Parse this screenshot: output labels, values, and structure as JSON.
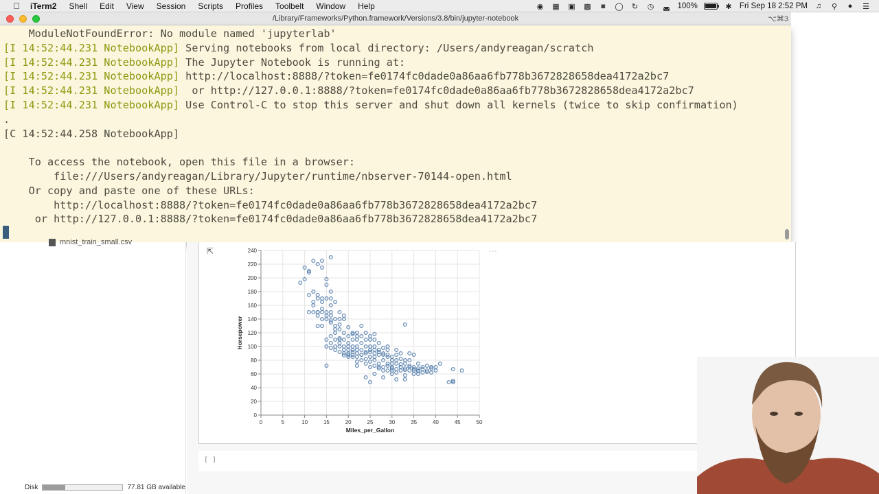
{
  "menubar": {
    "app_name": "iTerm2",
    "items": [
      "Shell",
      "Edit",
      "View",
      "Session",
      "Scripts",
      "Profiles",
      "Toolbelt",
      "Window",
      "Help"
    ],
    "battery_text": "100%",
    "battery_level": 1.0,
    "clock": "Fri Sep 18  2:52 PM"
  },
  "terminal": {
    "window_title": "/Library/Frameworks/Python.framework/Versions/3.8/bin/jupyter-notebook",
    "shortcut": "⌥⌘3",
    "lines": [
      {
        "tag": "",
        "text": "    ModuleNotFoundError: No module named 'jupyterlab'"
      },
      {
        "tag": "[I 14:52:44.231 NotebookApp]",
        "text": " Serving notebooks from local directory: /Users/andyreagan/scratch"
      },
      {
        "tag": "[I 14:52:44.231 NotebookApp]",
        "text": " The Jupyter Notebook is running at:"
      },
      {
        "tag": "[I 14:52:44.231 NotebookApp]",
        "text": " http://localhost:8888/?token=fe0174fc0dade0a86aa6fb778b3672828658dea4172a2bc7"
      },
      {
        "tag": "[I 14:52:44.231 NotebookApp]",
        "text": "  or http://127.0.0.1:8888/?token=fe0174fc0dade0a86aa6fb778b3672828658dea4172a2bc7"
      },
      {
        "tag": "[I 14:52:44.231 NotebookApp]",
        "text": " Use Control-C to stop this server and shut down all kernels (twice to skip confirmation)"
      },
      {
        "tag": "",
        "text": "."
      },
      {
        "tag": "",
        "text": "[C 14:52:44.258 NotebookApp]"
      },
      {
        "tag": "",
        "text": ""
      },
      {
        "tag": "",
        "text": "    To access the notebook, open this file in a browser:"
      },
      {
        "tag": "",
        "text": "        file:///Users/andyreagan/Library/Jupyter/runtime/nbserver-70144-open.html"
      },
      {
        "tag": "",
        "text": "    Or copy and paste one of these URLs:"
      },
      {
        "tag": "",
        "text": "        http://localhost:8888/?token=fe0174fc0dade0a86aa6fb778b3672828658dea4172a2bc7"
      },
      {
        "tag": "",
        "text": "     or http://127.0.0.1:8888/?token=fe0174fc0dade0a86aa6fb778b3672828658dea4172a2bc7"
      }
    ]
  },
  "jupyter": {
    "file_partial": "mnist_train_small.csv",
    "disk_label": "Disk",
    "disk_available": "77.81 GB available",
    "disk_used_fraction": 0.28,
    "input_prompt": "[ ]"
  },
  "chart_data": {
    "type": "scatter",
    "xlabel": "Miles_per_Gallon",
    "ylabel": "Horsepower",
    "xlim": [
      0,
      50
    ],
    "ylim": [
      0,
      240
    ],
    "xticks": [
      0,
      5,
      10,
      15,
      20,
      25,
      30,
      35,
      40,
      45,
      50
    ],
    "yticks": [
      0,
      20,
      40,
      60,
      80,
      100,
      120,
      140,
      160,
      180,
      200,
      220,
      240
    ],
    "grid": true,
    "color": "#4c78a8",
    "points": [
      [
        9,
        193
      ],
      [
        10,
        215
      ],
      [
        11,
        210
      ],
      [
        12,
        225
      ],
      [
        13,
        220
      ],
      [
        14,
        225
      ],
      [
        14,
        215
      ],
      [
        16,
        230
      ],
      [
        10,
        198
      ],
      [
        11,
        208
      ],
      [
        12,
        180
      ],
      [
        13,
        170
      ],
      [
        14,
        165
      ],
      [
        15,
        198
      ],
      [
        15,
        190
      ],
      [
        16,
        180
      ],
      [
        16,
        170
      ],
      [
        17,
        165
      ],
      [
        18,
        150
      ],
      [
        19,
        145
      ],
      [
        11,
        150
      ],
      [
        12,
        160
      ],
      [
        12,
        150
      ],
      [
        13,
        145
      ],
      [
        13,
        150
      ],
      [
        14,
        140
      ],
      [
        14,
        150
      ],
      [
        14,
        155
      ],
      [
        15,
        150
      ],
      [
        15,
        145
      ],
      [
        15,
        140
      ],
      [
        16,
        150
      ],
      [
        16,
        138
      ],
      [
        16,
        135
      ],
      [
        16,
        145
      ],
      [
        17,
        140
      ],
      [
        17,
        130
      ],
      [
        17,
        120
      ],
      [
        18,
        140
      ],
      [
        18,
        125
      ],
      [
        13,
        130
      ],
      [
        13,
        175
      ],
      [
        14,
        170
      ],
      [
        15,
        170
      ],
      [
        16,
        160
      ],
      [
        15,
        110
      ],
      [
        16,
        115
      ],
      [
        17,
        110
      ],
      [
        18,
        110
      ],
      [
        18,
        105
      ],
      [
        18,
        100
      ],
      [
        19,
        100
      ],
      [
        19,
        110
      ],
      [
        19,
        95
      ],
      [
        20,
        90
      ],
      [
        20,
        95
      ],
      [
        20,
        100
      ],
      [
        20,
        105
      ],
      [
        21,
        110
      ],
      [
        21,
        100
      ],
      [
        21,
        95
      ],
      [
        21,
        88
      ],
      [
        22,
        95
      ],
      [
        22,
        100
      ],
      [
        22,
        110
      ],
      [
        22,
        115
      ],
      [
        22,
        85
      ],
      [
        23,
        105
      ],
      [
        23,
        95
      ],
      [
        23,
        88
      ],
      [
        24,
        100
      ],
      [
        24,
        90
      ],
      [
        24,
        110
      ],
      [
        24,
        120
      ],
      [
        25,
        95
      ],
      [
        25,
        85
      ],
      [
        25,
        92
      ],
      [
        25,
        100
      ],
      [
        25,
        110
      ],
      [
        26,
        90
      ],
      [
        26,
        85
      ],
      [
        26,
        95
      ],
      [
        26,
        100
      ],
      [
        26,
        80
      ],
      [
        27,
        88
      ],
      [
        27,
        95
      ],
      [
        27,
        75
      ],
      [
        27,
        68
      ],
      [
        28,
        90
      ],
      [
        28,
        80
      ],
      [
        28,
        70
      ],
      [
        28,
        88
      ],
      [
        29,
        95
      ],
      [
        29,
        85
      ],
      [
        29,
        75
      ],
      [
        30,
        70
      ],
      [
        30,
        80
      ],
      [
        30,
        85
      ],
      [
        30,
        65
      ],
      [
        31,
        75
      ],
      [
        31,
        67
      ],
      [
        31,
        80
      ],
      [
        32,
        90
      ],
      [
        32,
        70
      ],
      [
        32,
        65
      ],
      [
        33,
        75
      ],
      [
        33,
        68
      ],
      [
        33,
        58
      ],
      [
        34,
        70
      ],
      [
        34,
        80
      ],
      [
        34,
        65
      ],
      [
        35,
        70
      ],
      [
        35,
        67
      ],
      [
        36,
        65
      ],
      [
        36,
        75
      ],
      [
        36,
        60
      ],
      [
        37,
        67
      ],
      [
        37,
        70
      ],
      [
        38,
        65
      ],
      [
        38,
        63
      ],
      [
        39,
        62
      ],
      [
        39,
        70
      ],
      [
        40,
        65
      ],
      [
        41,
        75
      ],
      [
        43,
        48
      ],
      [
        44,
        50
      ],
      [
        44,
        48
      ],
      [
        44,
        67
      ],
      [
        46,
        65
      ],
      [
        33,
        132
      ],
      [
        19,
        90
      ],
      [
        20,
        88
      ],
      [
        21,
        85
      ],
      [
        22,
        78
      ],
      [
        23,
        80
      ],
      [
        24,
        75
      ],
      [
        25,
        70
      ],
      [
        26,
        72
      ],
      [
        27,
        70
      ],
      [
        28,
        65
      ],
      [
        29,
        65
      ],
      [
        30,
        60
      ],
      [
        31,
        52
      ],
      [
        32,
        70
      ],
      [
        33,
        52
      ],
      [
        35,
        60
      ],
      [
        36,
        68
      ],
      [
        34,
        90
      ],
      [
        35,
        88
      ],
      [
        31,
        95
      ],
      [
        29,
        100
      ],
      [
        27,
        105
      ],
      [
        26,
        110
      ],
      [
        25,
        115
      ],
      [
        24,
        92
      ],
      [
        23,
        115
      ],
      [
        22,
        120
      ],
      [
        21,
        118
      ],
      [
        20,
        115
      ],
      [
        19,
        120
      ],
      [
        18,
        112
      ],
      [
        17,
        100
      ],
      [
        16,
        105
      ],
      [
        15,
        100
      ],
      [
        14,
        130
      ],
      [
        13,
        150
      ],
      [
        12,
        165
      ],
      [
        11,
        175
      ],
      [
        15,
        72
      ],
      [
        22,
        72
      ],
      [
        24,
        55
      ],
      [
        25,
        48
      ],
      [
        26,
        60
      ],
      [
        28,
        55
      ],
      [
        30,
        75
      ],
      [
        29,
        72
      ],
      [
        31,
        88
      ],
      [
        32,
        82
      ],
      [
        33,
        80
      ],
      [
        34,
        72
      ],
      [
        17,
        125
      ],
      [
        18,
        132
      ],
      [
        19,
        140
      ],
      [
        20,
        128
      ],
      [
        21,
        120
      ],
      [
        23,
        130
      ],
      [
        26,
        118
      ],
      [
        27,
        92
      ],
      [
        28,
        98
      ],
      [
        29,
        88
      ],
      [
        16,
        98
      ],
      [
        17,
        95
      ],
      [
        18,
        92
      ],
      [
        19,
        87
      ],
      [
        20,
        85
      ],
      [
        21,
        92
      ],
      [
        22,
        90
      ],
      [
        23,
        88
      ],
      [
        24,
        82
      ],
      [
        25,
        78
      ],
      [
        38,
        72
      ],
      [
        39,
        68
      ],
      [
        40,
        70
      ],
      [
        37,
        62
      ],
      [
        35,
        65
      ],
      [
        36,
        64
      ],
      [
        33,
        66
      ],
      [
        32,
        74
      ],
      [
        30,
        68
      ],
      [
        31,
        62
      ]
    ]
  }
}
